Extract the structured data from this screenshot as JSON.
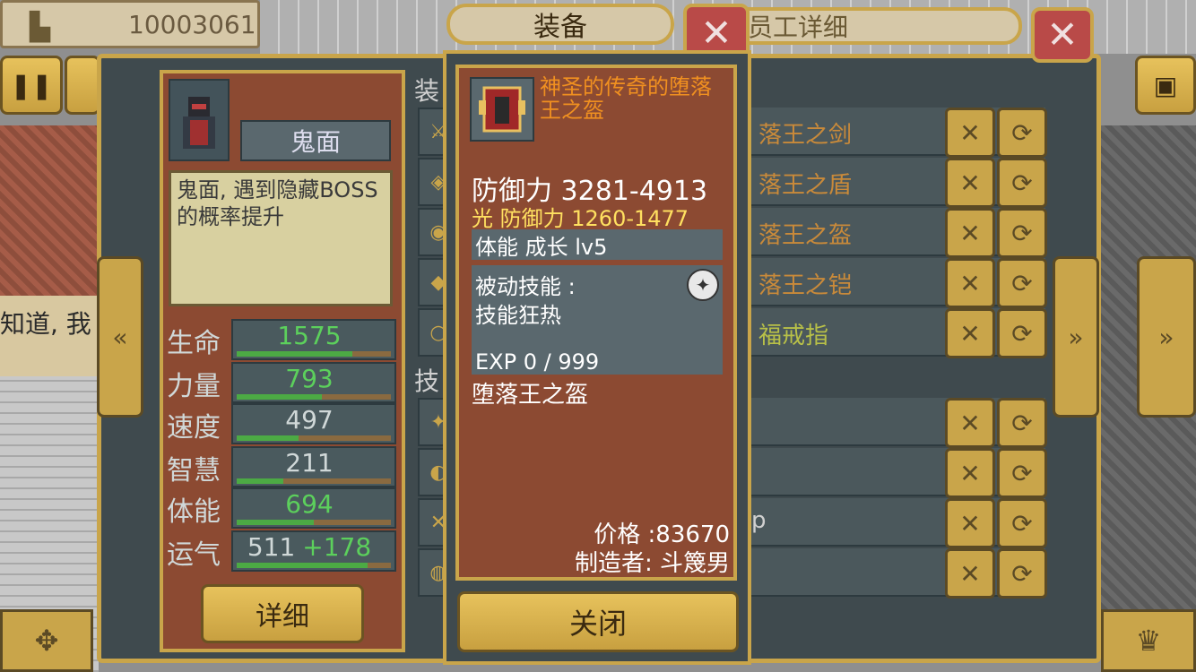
{
  "money": {
    "icon": "building-icon",
    "value": "10003061"
  },
  "window": {
    "detail_title": "员工详细",
    "close_icon": "close-icon"
  },
  "employee": {
    "name": "鬼面",
    "description": "鬼面, 遇到隐藏BOSS的概率提升",
    "stats": [
      {
        "label": "生命",
        "value": "1575",
        "bonus": "",
        "color": "#5cd05c",
        "fill": 0.75
      },
      {
        "label": "力量",
        "value": "793",
        "bonus": "",
        "color": "#5cd05c",
        "fill": 0.55
      },
      {
        "label": "速度",
        "value": "497",
        "bonus": "",
        "color": "#d0d8d8",
        "fill": 0.4
      },
      {
        "label": "智慧",
        "value": "211",
        "bonus": "",
        "color": "#d0d8d8",
        "fill": 0.3
      },
      {
        "label": "体能",
        "value": "694",
        "bonus": "",
        "color": "#5cd05c",
        "fill": 0.5
      },
      {
        "label": "运气",
        "value": "511",
        "bonus": "+178",
        "color": "#d0d8d8",
        "fill": 0.85
      }
    ],
    "detail_button": "详细"
  },
  "equipment_list": {
    "section_equip": "装",
    "section_skill": "技",
    "items": [
      {
        "label": "落王之剑",
        "color": "orange"
      },
      {
        "label": "落王之盾",
        "color": "orange"
      },
      {
        "label": "落王之盔",
        "color": "orange"
      },
      {
        "label": "落王之铠",
        "color": "orange"
      },
      {
        "label": "福戒指",
        "color": "green"
      }
    ],
    "skill_rows": 4,
    "partial_text": "p"
  },
  "popup": {
    "tab_label": "装备",
    "item_name_title": "神圣的传奇的堕落王之盔",
    "defense": "防御力 3281-4913",
    "light_defense": "光 防御力 1260-1477",
    "growth": "体能 成长 lv5",
    "passive_label": "被动技能 :",
    "skill_name": "技能狂热",
    "exp": "EXP 0 / 999",
    "item_name": "堕落王之盔",
    "price": "价格 :83670",
    "maker": "制造者: 斗篾男",
    "close_button": "关闭"
  },
  "background": {
    "bubble_text": "知道, 我"
  }
}
